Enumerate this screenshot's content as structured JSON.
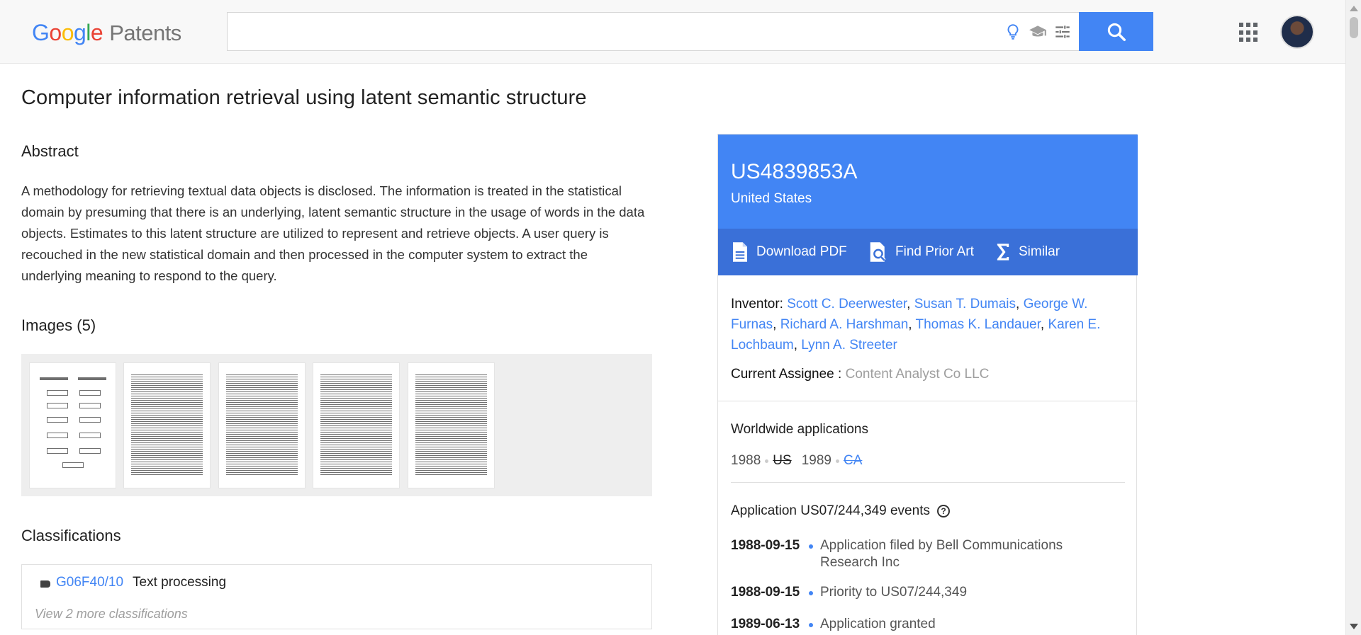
{
  "header": {
    "logo": {
      "g1": "G",
      "g2": "o",
      "g3": "o",
      "g4": "g",
      "g5": "l",
      "g6": "e",
      "suffix": "Patents"
    },
    "search_value": "",
    "icons": [
      "lightbulb-icon",
      "graduation-cap-icon",
      "tune-icon",
      "search-icon",
      "apps-grid-icon",
      "avatar"
    ]
  },
  "colors": {
    "brand_blue": "#4285f4",
    "action_bar": "#3a70d8"
  },
  "main": {
    "title": "Computer information retrieval using latent semantic structure",
    "abstract_heading": "Abstract",
    "abstract_text": "A methodology for retrieving textual data objects is disclosed. The information is treated in the statistical domain by presuming that there is an underlying, latent semantic structure in the usage of words in the data objects. Estimates to this latent structure are utilized to represent and retrieve objects. A user query is recouched in the new statistical domain and then processed in the computer system to extract the underlying meaning to respond to the query.",
    "images_heading": "Images (5)",
    "classifications_heading": "Classifications",
    "classification": {
      "code": "G06F40/10",
      "description": "Text processing"
    },
    "more_classifications": "View 2 more classifications"
  },
  "card": {
    "publication_number": "US4839853A",
    "country": "United States",
    "actions": {
      "download": "Download PDF",
      "prior_art": "Find Prior Art",
      "similar": "Similar"
    },
    "inventor_label": "Inventor:",
    "inventors": [
      "Scott C. Deerwester",
      "Susan T. Dumais",
      "George W. Furnas",
      "Richard A. Harshman",
      "Thomas K. Landauer",
      "Karen E. Lochbaum",
      "Lynn A. Streeter"
    ],
    "assignee_label": "Current Assignee :",
    "assignee": "Content Analyst Co LLC",
    "worldwide_title": "Worldwide applications",
    "worldwide": {
      "y1": "1988",
      "c1": "US",
      "y2": "1989",
      "c2": "CA"
    },
    "events_title": "Application US07/244,349 events",
    "help": "?",
    "events": [
      {
        "date": "1988-09-15",
        "desc": "Application filed by Bell Communications Research Inc"
      },
      {
        "date": "1988-09-15",
        "desc": "Priority to US07/244,349"
      },
      {
        "date": "1989-06-13",
        "desc": "Application granted"
      }
    ]
  }
}
